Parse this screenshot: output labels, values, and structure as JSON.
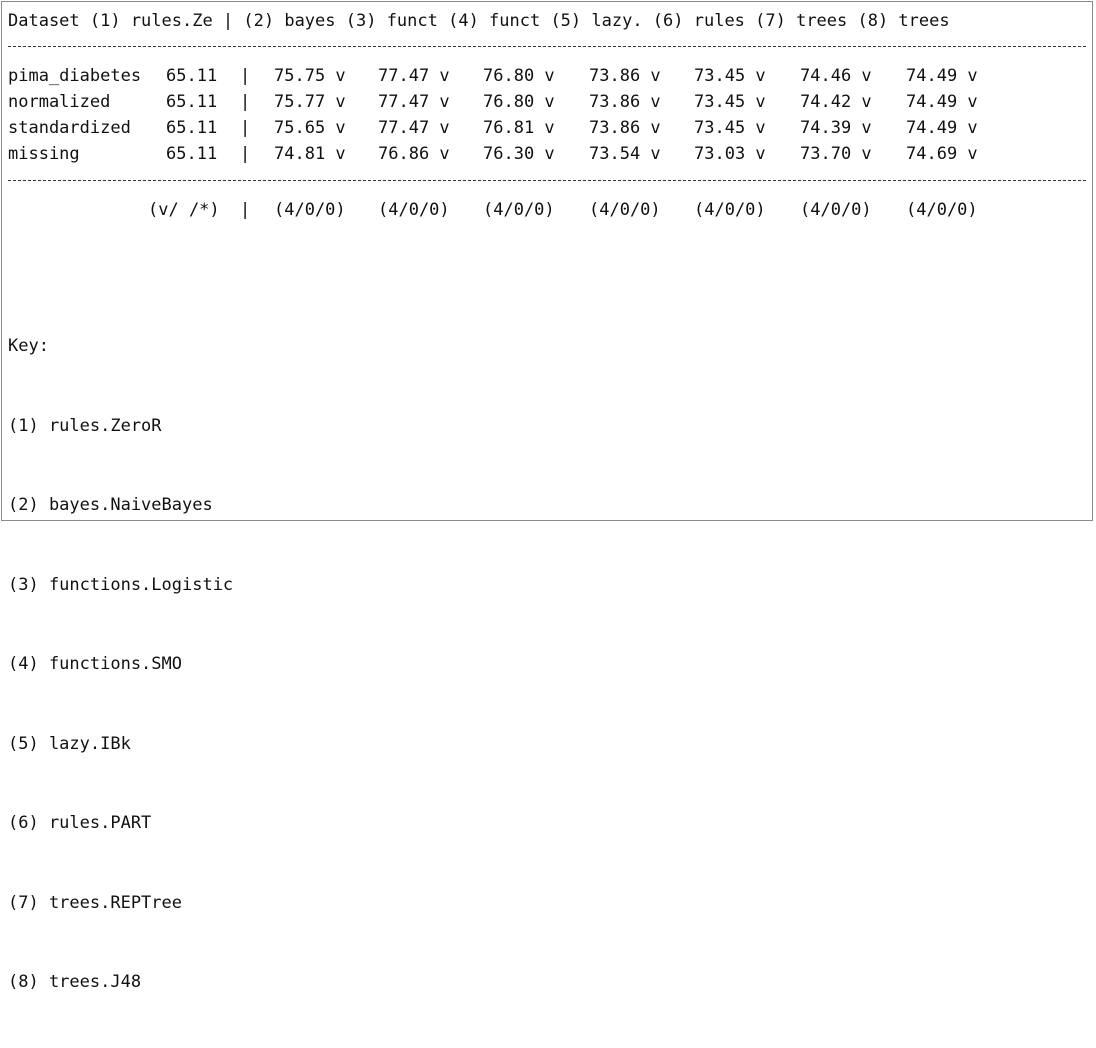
{
  "header": "Dataset (1) rules.Ze | (2) bayes (3) funct (4) funct (5) lazy. (6) rules (7) trees (8) trees",
  "rows": [
    {
      "dataset": "pima_diabetes",
      "baseline": "65.11",
      "sep": "|",
      "values": [
        "75.75 v",
        "77.47 v",
        "76.80 v",
        "73.86 v",
        "73.45 v",
        "74.46 v",
        "74.49 v"
      ]
    },
    {
      "dataset": "normalized",
      "baseline": "65.11",
      "sep": "|",
      "values": [
        "75.77 v",
        "77.47 v",
        "76.80 v",
        "73.86 v",
        "73.45 v",
        "74.42 v",
        "74.49 v"
      ]
    },
    {
      "dataset": "standardized",
      "baseline": "65.11",
      "sep": "|",
      "values": [
        "75.65 v",
        "77.47 v",
        "76.81 v",
        "73.86 v",
        "73.45 v",
        "74.39 v",
        "74.49 v"
      ]
    },
    {
      "dataset": "missing",
      "baseline": "65.11",
      "sep": "|",
      "values": [
        "74.81 v",
        "76.86 v",
        "76.30 v",
        "73.54 v",
        "73.03 v",
        "73.70 v",
        "74.69 v"
      ]
    }
  ],
  "summary": {
    "label": "(v/ /*)",
    "sep": "|",
    "values": [
      "(4/0/0)",
      "(4/0/0)",
      "(4/0/0)",
      "(4/0/0)",
      "(4/0/0)",
      "(4/0/0)",
      "(4/0/0)"
    ]
  },
  "key": {
    "title": "Key:",
    "items": [
      "(1) rules.ZeroR",
      "(2) bayes.NaiveBayes",
      "(3) functions.Logistic",
      "(4) functions.SMO",
      "(5) lazy.IBk",
      "(6) rules.PART",
      "(7) trees.REPTree",
      "(8) trees.J48"
    ]
  }
}
